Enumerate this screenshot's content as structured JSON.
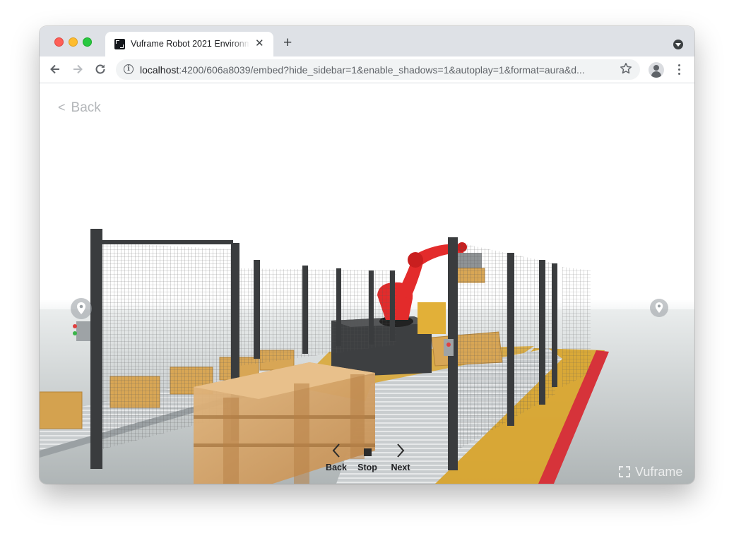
{
  "browser": {
    "tab_title": "Vuframe Robot 2021 Environment",
    "tab_close": "✕",
    "new_tab": "+",
    "url_host": "localhost",
    "url_rest": ":4200/606a8039/embed?hide_sidebar=1&enable_shadows=1&autoplay=1&format=aura&d...",
    "icons": {
      "back": "arrow-left-icon",
      "forward": "arrow-right-icon",
      "reload": "reload-icon",
      "info": "info-icon",
      "star": "star-icon",
      "profile": "profile-icon",
      "menu": "kebab-menu-icon"
    }
  },
  "page": {
    "back_label": "Back",
    "controls": {
      "back_label": "Back",
      "stop_label": "Stop",
      "next_label": "Next"
    },
    "watermark": "Vuframe",
    "accent_colors": {
      "robot": "#e32b2b",
      "floor_zone": "#d9a52e",
      "safety_line": "#d6333a"
    }
  }
}
